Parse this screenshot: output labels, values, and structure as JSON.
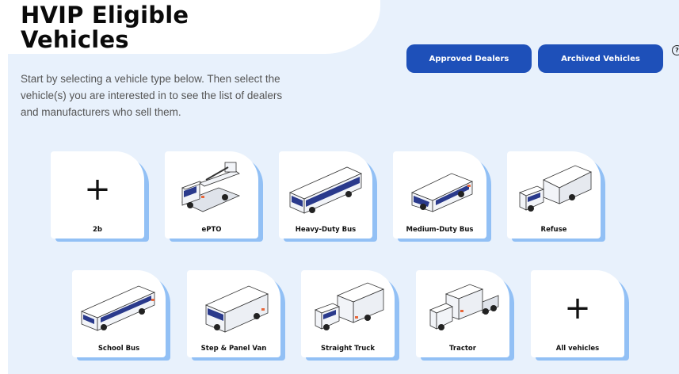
{
  "header": {
    "title_line1": "HVIP Eligible",
    "title_line2": "Vehicles"
  },
  "buttons": {
    "approved_dealers": "Approved Dealers",
    "archived_vehicles": "Archived Vehicles",
    "help": "?"
  },
  "intro_text": "Start by selecting a vehicle type below. Then select the vehicle(s) you are interested in to see the list of dealers and manufacturers who sell them.",
  "vehicle_types": [
    {
      "label": "2b",
      "icon": "plus-icon",
      "glyph": "+"
    },
    {
      "label": "ePTO",
      "icon": "bucket-truck-icon"
    },
    {
      "label": "Heavy-Duty Bus",
      "icon": "transit-bus-icon"
    },
    {
      "label": "Medium-Duty Bus",
      "icon": "shuttle-bus-icon"
    },
    {
      "label": "Refuse",
      "icon": "garbage-truck-icon"
    },
    {
      "label": "School Bus",
      "icon": "school-bus-icon"
    },
    {
      "label": "Step & Panel Van",
      "icon": "step-van-icon"
    },
    {
      "label": "Straight Truck",
      "icon": "box-truck-icon"
    },
    {
      "label": "Tractor",
      "icon": "semi-tractor-icon"
    },
    {
      "label": "All vehicles",
      "icon": "plus-icon",
      "glyph": "+"
    }
  ],
  "colors": {
    "accent": "#1e50b9",
    "panel_bg": "#e8f1fc",
    "card_shadow": "#92c0f5",
    "vehicle_body": "#f2f4f8",
    "vehicle_trim": "#2a3a8c",
    "vehicle_accent": "#e8673a"
  }
}
